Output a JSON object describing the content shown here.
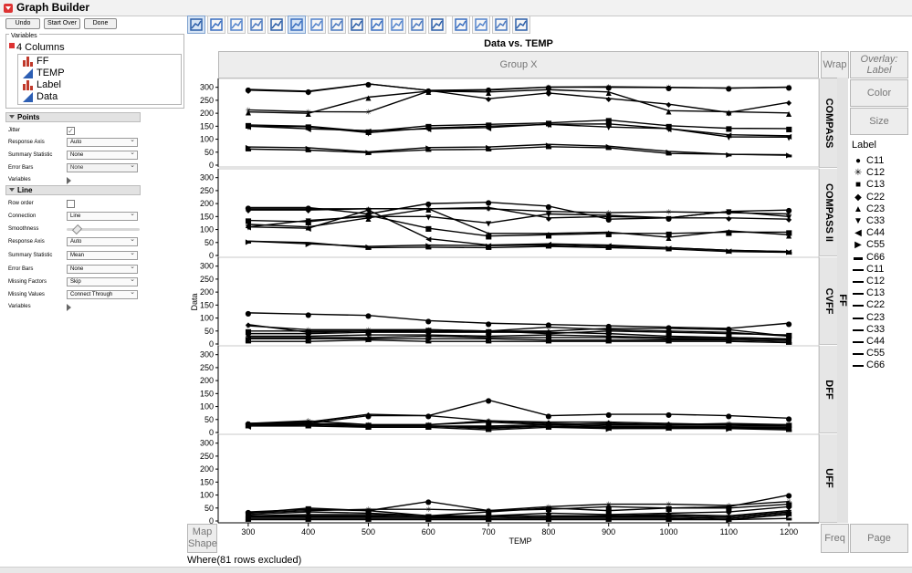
{
  "window": {
    "title": "Graph Builder"
  },
  "top_buttons": [
    "Undo",
    "Start Over",
    "Done"
  ],
  "variables": {
    "section_label": "Variables",
    "columns_label": "4 Columns",
    "items": [
      {
        "label": "FF",
        "icon": "nominal-bar-icon"
      },
      {
        "label": "TEMP",
        "icon": "continuous-triangle-icon"
      },
      {
        "label": "Label",
        "icon": "nominal-bar-icon"
      },
      {
        "label": "Data",
        "icon": "continuous-triangle-icon"
      }
    ]
  },
  "points": {
    "header": "Points",
    "jitter_label": "Jitter",
    "jitter_checked": true,
    "response_axis_label": "Response Axis",
    "response_axis_value": "Auto",
    "summary_statistic_label": "Summary Statistic",
    "summary_statistic_value": "None",
    "error_bars_label": "Error Bars",
    "error_bars_value": "None",
    "variables_label": "Variables"
  },
  "line": {
    "header": "Line",
    "row_order_label": "Row order",
    "row_order_checked": false,
    "connection_label": "Connection",
    "connection_value": "Line",
    "smoothness_label": "Smoothness",
    "response_axis_label": "Response Axis",
    "response_axis_value": "Auto",
    "summary_statistic_label": "Summary Statistic",
    "summary_statistic_value": "Mean",
    "error_bars_label": "Error Bars",
    "error_bars_value": "None",
    "missing_factors_label": "Missing Factors",
    "missing_factors_value": "Skip",
    "missing_values_label": "Missing Values",
    "missing_values_value": "Connect Through",
    "variables_label": "Variables"
  },
  "toolbar": {
    "icons": [
      "points-icon",
      "smoother-icon",
      "line-of-fit-icon",
      "ellipse-icon",
      "contour-icon",
      "line-icon",
      "bar-icon",
      "area-icon",
      "box-plot-icon",
      "histogram-icon",
      "heatmap-icon",
      "pie-icon",
      "treemap-icon",
      "mosaic-icon",
      "caption-box-icon",
      "formula-icon",
      "map-shapes-icon",
      "street-map-icon"
    ],
    "selected": [
      0,
      5
    ]
  },
  "drop_zones": {
    "group_x": "Group X",
    "wrap": "Wrap",
    "overlay": "Overlay:",
    "overlay_value": "Label",
    "color": "Color",
    "size": "Size",
    "map_shape_1": "Map",
    "map_shape_2": "Shape",
    "freq": "Freq",
    "page": "Page"
  },
  "legend": {
    "title": "Label",
    "marker_items": [
      {
        "label": "C11",
        "glyph": "●"
      },
      {
        "label": "C12",
        "glyph": "✳"
      },
      {
        "label": "C13",
        "glyph": "■"
      },
      {
        "label": "C22",
        "glyph": "◆"
      },
      {
        "label": "C23",
        "glyph": "▲"
      },
      {
        "label": "C33",
        "glyph": "▼"
      },
      {
        "label": "C44",
        "glyph": "◀"
      },
      {
        "label": "C55",
        "glyph": "▶"
      },
      {
        "label": "C66",
        "glyph": "▬"
      }
    ],
    "line_items": [
      "C11",
      "C12",
      "C13",
      "C22",
      "C23",
      "C33",
      "C44",
      "C55",
      "C66"
    ]
  },
  "where_text": "Where(81 rows excluded)",
  "chart_data": {
    "type": "line",
    "title": "Data vs. TEMP",
    "xlabel": "TEMP",
    "ylabel": "Data",
    "group_y_label": "FF",
    "x": [
      300,
      400,
      500,
      600,
      700,
      800,
      900,
      1000,
      1100,
      1200
    ],
    "ylim": [
      0,
      320
    ],
    "yticks": [
      0,
      50,
      100,
      150,
      200,
      250,
      300
    ],
    "grid": false,
    "legend_position": "right",
    "panels": [
      {
        "name": "COMPASS",
        "series": [
          {
            "name": "C11",
            "values": [
              292,
              285,
              313,
              288,
              291,
              301,
              300,
              299,
              297,
              301
            ]
          },
          {
            "name": "C12",
            "values": [
              213,
              206,
              205,
              285,
              289,
              301,
              302,
              300,
              297,
              300
            ]
          },
          {
            "name": "C13",
            "values": [
              155,
              150,
              130,
              152,
              157,
              163,
              174,
              152,
              142,
              141
            ]
          },
          {
            "name": "C22",
            "values": [
              289,
              283,
              313,
              288,
              256,
              278,
              257,
              235,
              203,
              242
            ]
          },
          {
            "name": "C23",
            "values": [
              205,
              200,
              262,
              285,
              282,
              291,
              282,
              210,
              206,
              201
            ]
          },
          {
            "name": "C33",
            "values": [
              150,
              148,
              125,
              143,
              150,
              157,
              147,
              141,
              109,
              108
            ]
          },
          {
            "name": "C44",
            "values": [
              150,
              140,
              133,
              140,
              145,
              158,
              159,
              141,
              117,
              113
            ]
          },
          {
            "name": "C55",
            "values": [
              70,
              67,
              51,
              68,
              70,
              80,
              73,
              53,
              42,
              40
            ]
          },
          {
            "name": "C66",
            "values": [
              62,
              58,
              48,
              59,
              61,
              71,
              67,
              45,
              42,
              38
            ]
          }
        ]
      },
      {
        "name": "COMPASS II",
        "series": [
          {
            "name": "C11",
            "values": [
              185,
              185,
              160,
              200,
              205,
              190,
              140,
              145,
              170,
              175
            ]
          },
          {
            "name": "C12",
            "values": [
              180,
              180,
              180,
              180,
              180,
              170,
              165,
              168,
              165,
              160
            ]
          },
          {
            "name": "C13",
            "values": [
              135,
              130,
              155,
              105,
              75,
              80,
              85,
              85,
              90,
              90
            ]
          },
          {
            "name": "C22",
            "values": [
              175,
              175,
              180,
              180,
              185,
              145,
              150,
              145,
              145,
              140
            ]
          },
          {
            "name": "C23",
            "values": [
              120,
              110,
              145,
              180,
              85,
              85,
              90,
              70,
              95,
              80
            ]
          },
          {
            "name": "C33",
            "values": [
              110,
              135,
              150,
              150,
              125,
              160,
              155,
              145,
              170,
              150
            ]
          },
          {
            "name": "C44",
            "values": [
              110,
              105,
              175,
              65,
              40,
              45,
              40,
              30,
              20,
              15
            ]
          },
          {
            "name": "C55",
            "values": [
              55,
              45,
              35,
              40,
              38,
              40,
              35,
              30,
              20,
              15
            ]
          },
          {
            "name": "C66",
            "values": [
              55,
              50,
              30,
              32,
              30,
              35,
              30,
              25,
              15,
              12
            ]
          }
        ]
      },
      {
        "name": "CVFF",
        "series": [
          {
            "name": "C11",
            "values": [
              120,
              115,
              110,
              90,
              80,
              75,
              70,
              65,
              60,
              80
            ]
          },
          {
            "name": "C12",
            "values": [
              70,
              55,
              55,
              55,
              50,
              65,
              55,
              50,
              45,
              30
            ]
          },
          {
            "name": "C13",
            "values": [
              50,
              50,
              50,
              55,
              50,
              40,
              50,
              45,
              40,
              35
            ]
          },
          {
            "name": "C22",
            "values": [
              75,
              45,
              50,
              50,
              50,
              50,
              60,
              60,
              55,
              30
            ]
          },
          {
            "name": "C23",
            "values": [
              40,
              40,
              45,
              45,
              45,
              45,
              40,
              30,
              25,
              20
            ]
          },
          {
            "name": "C33",
            "values": [
              30,
              30,
              35,
              35,
              30,
              35,
              30,
              25,
              25,
              20
            ]
          },
          {
            "name": "C44",
            "values": [
              25,
              25,
              25,
              30,
              25,
              25,
              25,
              20,
              20,
              15
            ]
          },
          {
            "name": "C55",
            "values": [
              20,
              20,
              20,
              20,
              20,
              15,
              15,
              15,
              15,
              10
            ]
          },
          {
            "name": "C66",
            "values": [
              10,
              10,
              15,
              10,
              10,
              10,
              10,
              10,
              10,
              5
            ]
          }
        ]
      },
      {
        "name": "DFF",
        "series": [
          {
            "name": "C11",
            "values": [
              35,
              35,
              65,
              65,
              125,
              65,
              70,
              70,
              65,
              55
            ]
          },
          {
            "name": "C12",
            "values": [
              35,
              45,
              30,
              30,
              45,
              35,
              30,
              30,
              35,
              30
            ]
          },
          {
            "name": "C13",
            "values": [
              30,
              35,
              30,
              30,
              40,
              30,
              35,
              30,
              30,
              30
            ]
          },
          {
            "name": "C22",
            "values": [
              35,
              40,
              70,
              65,
              45,
              40,
              40,
              35,
              30,
              25
            ]
          },
          {
            "name": "C23",
            "values": [
              30,
              30,
              25,
              25,
              25,
              30,
              25,
              25,
              25,
              25
            ]
          },
          {
            "name": "C33",
            "values": [
              30,
              30,
              25,
              25,
              20,
              25,
              20,
              25,
              20,
              20
            ]
          },
          {
            "name": "C44",
            "values": [
              25,
              30,
              25,
              25,
              20,
              25,
              20,
              20,
              20,
              15
            ]
          },
          {
            "name": "C55",
            "values": [
              30,
              30,
              25,
              25,
              15,
              25,
              15,
              20,
              15,
              15
            ]
          },
          {
            "name": "C66",
            "values": [
              25,
              25,
              20,
              20,
              10,
              20,
              15,
              15,
              15,
              10
            ]
          }
        ]
      },
      {
        "name": "UFF",
        "series": [
          {
            "name": "C11",
            "values": [
              35,
              45,
              40,
              75,
              40,
              45,
              55,
              50,
              55,
              100
            ]
          },
          {
            "name": "C12",
            "values": [
              30,
              40,
              45,
              45,
              40,
              55,
              65,
              65,
              60,
              75
            ]
          },
          {
            "name": "C13",
            "values": [
              30,
              50,
              40,
              20,
              35,
              50,
              40,
              50,
              50,
              65
            ]
          },
          {
            "name": "C22",
            "values": [
              25,
              35,
              30,
              20,
              20,
              30,
              25,
              30,
              35,
              55
            ]
          },
          {
            "name": "C23",
            "values": [
              20,
              25,
              25,
              20,
              20,
              20,
              20,
              25,
              20,
              40
            ]
          },
          {
            "name": "C33",
            "values": [
              20,
              20,
              20,
              15,
              15,
              20,
              20,
              20,
              15,
              35
            ]
          },
          {
            "name": "C44",
            "values": [
              15,
              15,
              15,
              15,
              10,
              15,
              15,
              15,
              10,
              30
            ]
          },
          {
            "name": "C55",
            "values": [
              10,
              10,
              10,
              10,
              10,
              10,
              10,
              10,
              5,
              25
            ]
          },
          {
            "name": "C66",
            "values": [
              5,
              5,
              5,
              5,
              5,
              5,
              5,
              5,
              5,
              10
            ]
          }
        ]
      }
    ]
  }
}
